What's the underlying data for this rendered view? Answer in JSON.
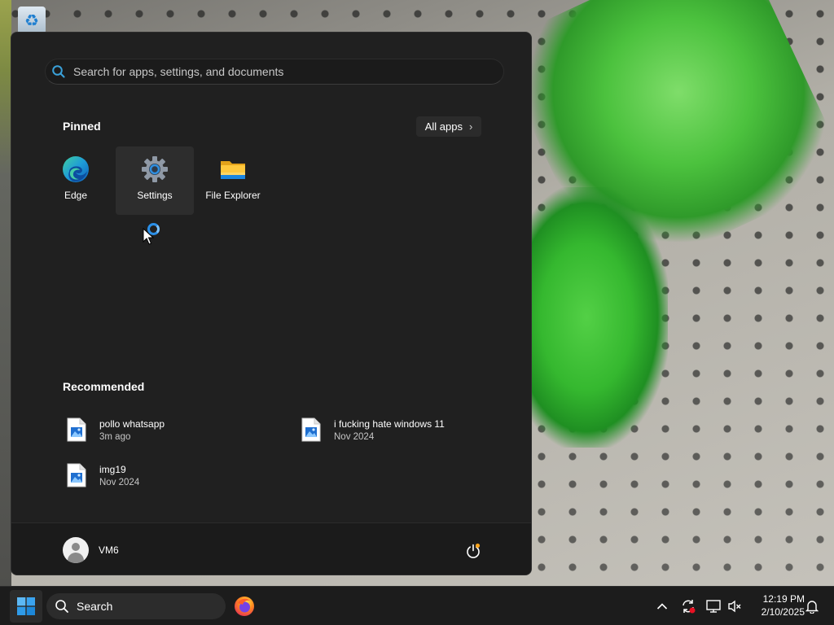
{
  "start_menu": {
    "search_placeholder": "Search for apps, settings, and documents",
    "pinned_title": "Pinned",
    "all_apps_label": "All apps",
    "pinned_apps": [
      {
        "label": "Edge",
        "icon": "edge-icon"
      },
      {
        "label": "Settings",
        "icon": "settings-gear-icon"
      },
      {
        "label": "File Explorer",
        "icon": "folder-icon"
      }
    ],
    "recommended_title": "Recommended",
    "recommended": [
      {
        "name": "pollo whatsapp",
        "time": "3m ago",
        "icon": "image-file-icon"
      },
      {
        "name": "i fucking hate windows 11",
        "time": "Nov 2024",
        "icon": "image-file-icon"
      },
      {
        "name": "img19",
        "time": "Nov 2024",
        "icon": "image-file-icon"
      }
    ],
    "user_name": "VM6"
  },
  "taskbar": {
    "search_label": "Search",
    "time": "12:19 PM",
    "date": "2/10/2025"
  },
  "colors": {
    "accent": "#0078d4",
    "menu_bg": "#202020",
    "taskbar_bg": "#1c1c1c",
    "folder_yellow": "#ffca28"
  }
}
